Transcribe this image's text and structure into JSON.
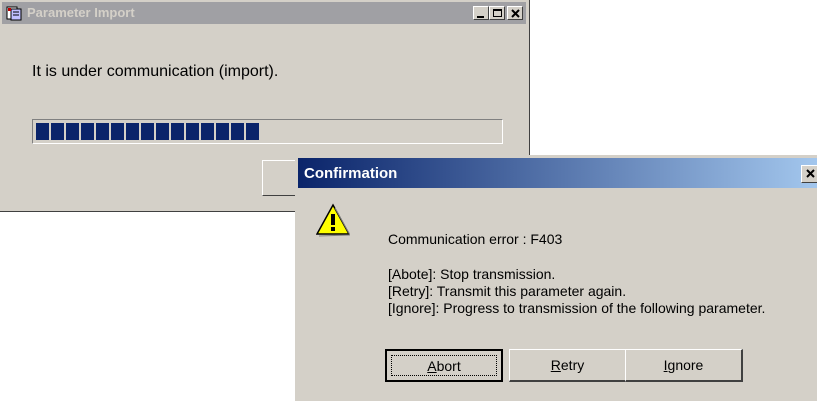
{
  "import_window": {
    "title": "Parameter Import",
    "message": "It is under communication (import).",
    "progress_fraction": 0.45,
    "segments_filled": 15
  },
  "confirm_dialog": {
    "title": "Confirmation",
    "error_line": "Communication error : F403",
    "abort_line": "[Abote]: Stop transmission.",
    "retry_line": "[Retry]: Transmit this parameter again.",
    "ignore_line": "[Ignore]: Progress to transmission of the following parameter.",
    "buttons": {
      "abort": {
        "first": "A",
        "rest": "bort"
      },
      "retry": {
        "first": "R",
        "rest": "etry"
      },
      "ignore": {
        "first": "I",
        "rest": "gnore"
      }
    }
  },
  "colors": {
    "progress": "#0a246a",
    "active_title_start": "#0a246a",
    "active_title_end": "#a6caf0",
    "inactive_title": "#a0a0a4",
    "face": "#d4d0c8"
  },
  "icons": [
    "app-icon",
    "minimize-icon",
    "maximize-icon",
    "close-icon",
    "warning-icon"
  ]
}
